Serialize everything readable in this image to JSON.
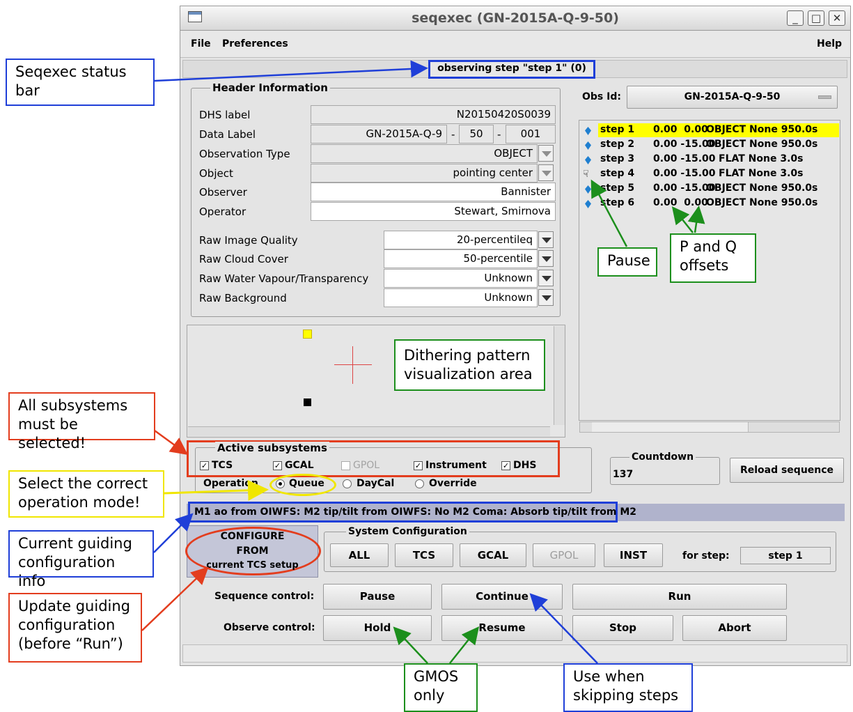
{
  "window": {
    "title": "seqexec (GN-2015A-Q-9-50)",
    "min_icon": "_",
    "max_icon": "□",
    "close_icon": "✕"
  },
  "menu": {
    "file": "File",
    "preferences": "Preferences",
    "help": "Help"
  },
  "status_bar": "observing step \"step 1\" (0)",
  "header": {
    "title": "Header Information",
    "dhs_label": {
      "label": "DHS label",
      "value": "N20150420S0039"
    },
    "data_label": {
      "label": "Data Label",
      "part1": "GN-2015A-Q-9",
      "sep": "-",
      "part2": "50",
      "part3": "001"
    },
    "observation_type": {
      "label": "Observation Type",
      "value": "OBJECT"
    },
    "object": {
      "label": "Object",
      "value": "pointing center"
    },
    "observer": {
      "label": "Observer",
      "value": "Bannister"
    },
    "operator": {
      "label": "Operator",
      "value": "Stewart, Smirnova"
    },
    "raw_iq": {
      "label": "Raw Image Quality",
      "value": "20-percentileq"
    },
    "raw_cc": {
      "label": "Raw Cloud Cover",
      "value": "50-percentile"
    },
    "raw_wv": {
      "label": "Raw Water Vapour/Transparency",
      "value": "Unknown"
    },
    "raw_bg": {
      "label": "Raw Background",
      "value": "Unknown"
    }
  },
  "obs_id": {
    "label": "Obs Id:",
    "value": "GN-2015A-Q-9-50"
  },
  "steps": [
    {
      "name": "step 1",
      "offsets": "0.00  0.00",
      "rest": "OBJECT None 950.0s",
      "highlight": true,
      "icon": "gem-icon"
    },
    {
      "name": "step 2",
      "offsets": "0.00 -15.00",
      "rest": "OBJECT None 950.0s",
      "highlight": false,
      "icon": "gem-icon"
    },
    {
      "name": "step 3",
      "offsets": "0.00 -15.00",
      "rest": "FLAT None 3.0s",
      "highlight": false,
      "icon": "gem-icon"
    },
    {
      "name": "step 4",
      "offsets": "0.00 -15.00",
      "rest": "FLAT None 3.0s",
      "highlight": false,
      "icon": "pause-hand-icon"
    },
    {
      "name": "step 5",
      "offsets": "0.00 -15.00",
      "rest": "OBJECT None 950.0s",
      "highlight": false,
      "icon": "gem-icon"
    },
    {
      "name": "step 6",
      "offsets": "0.00  0.00",
      "rest": "OBJECT None 950.0s",
      "highlight": false,
      "icon": "gem-icon"
    }
  ],
  "subsystems": {
    "title": "Active subsystems",
    "tcs": "TCS",
    "gcal": "GCAL",
    "gpol": "GPOL",
    "instrument": "Instrument",
    "dhs": "DHS",
    "operation_label": "Operation",
    "queue": "Queue",
    "daycal": "DayCal",
    "override": "Override"
  },
  "countdown": {
    "label": "Countdown",
    "value": "137"
  },
  "reload": "Reload sequence",
  "guiding_info": "M1 ao from OIWFS: M2 tip/tilt from OIWFS: No M2 Coma: Absorb tip/tilt from M2",
  "configure_button": {
    "line1": "CONFIGURE",
    "line2": "FROM",
    "line3": "current TCS setup"
  },
  "system_config": {
    "title": "System Configuration",
    "all": "ALL",
    "tcs": "TCS",
    "gcal": "GCAL",
    "gpol": "GPOL",
    "inst": "INST",
    "for_step_label": "for step:",
    "for_step_value": "step 1"
  },
  "sequence_control": {
    "label": "Sequence control:",
    "pause": "Pause",
    "continue": "Continue",
    "run": "Run"
  },
  "observe_control": {
    "label": "Observe control:",
    "hold": "Hold",
    "resume": "Resume",
    "stop": "Stop",
    "abort": "Abort"
  },
  "annotations": {
    "status_bar": "Seqexec status bar",
    "subsystems": "All subsystems must be selected!",
    "operation": "Select the correct operation mode!",
    "guiding": "Current guiding configuration info",
    "update": "Update guiding configuration (before “Run”)",
    "dither": "Dithering pattern visualization area",
    "pause": "Pause",
    "pq": "P and Q offsets",
    "gmos": "GMOS only",
    "skip": "Use when skipping steps"
  },
  "colors": {
    "annotation_blue": "#1f3fd8",
    "annotation_red": "#e33d1e",
    "annotation_yellow": "#f0e600",
    "annotation_green": "#1c8f1c",
    "step_highlight": "#ffff00"
  }
}
